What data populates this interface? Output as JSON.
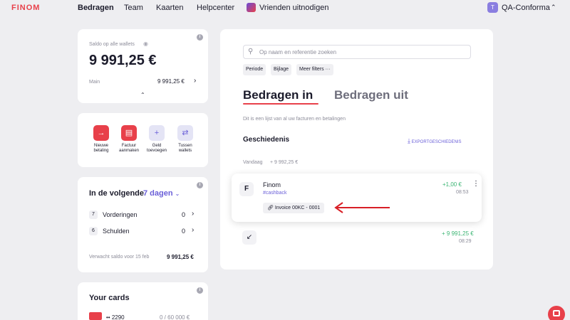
{
  "nav": {
    "logo": "FINOM",
    "items": [
      "Bedragen",
      "Team",
      "Kaarten",
      "Helpcenter",
      "Vrienden uitnodigen"
    ],
    "account_initial": "T",
    "account_name": "QA-Conforma"
  },
  "balance": {
    "label": "Saldo op alle wallets",
    "amount": "9 991,25 €",
    "wallet_name": "Main",
    "wallet_amount": "9 991,25 €"
  },
  "actions": [
    {
      "label_line1": "Nieuwe",
      "label_line2": "betaling",
      "icon": "arrow-right-icon",
      "color": "#e8404a"
    },
    {
      "label_line1": "Factuur",
      "label_line2": "aanmaken",
      "icon": "document-icon",
      "color": "#e8404a"
    },
    {
      "label_line1": "Geld",
      "label_line2": "toevoegen",
      "icon": "plus-icon",
      "color": "#e4e4f5"
    },
    {
      "label_line1": "Tussen",
      "label_line2": "wallets",
      "icon": "swap-icon",
      "color": "#e4e4f5"
    }
  ],
  "upcoming": {
    "title": "In de volgende",
    "period": "7 dagen",
    "rows": [
      {
        "badge": "7",
        "label": "Vorderingen",
        "value": "0"
      },
      {
        "badge": "6",
        "label": "Schulden",
        "value": "0"
      }
    ],
    "expected_label": "Verwacht saldo voor 15 feb",
    "expected_amount": "9 991,25 €"
  },
  "cards": {
    "title": "Your cards",
    "card_number": "•• 2290",
    "limit": "0 / 60 000 €"
  },
  "main": {
    "search_placeholder": "Op naam en referentie zoeken",
    "filters": [
      "Periode",
      "Bijlage",
      "Meer filters"
    ],
    "tab_in": "Bedragen in",
    "tab_out": "Bedragen uit",
    "description": "Dit is een lijst van al uw facturen en betalingen",
    "history_title": "Geschiedenis",
    "export_label": "EXPORTGESCHIEDENIS",
    "group_label": "Vandaag",
    "group_total": "+ 9 992,25 €",
    "transactions": [
      {
        "name": "Finom",
        "tag": "#cashback",
        "amount": "+1,00 €",
        "time": "08:53",
        "invoice": "Invoice 00KC - 0001"
      },
      {
        "amount": "+ 9 991,25 €",
        "time": "08:29"
      }
    ]
  },
  "colors": {
    "brand": "#e8404a",
    "accent": "#6a5fd8",
    "positive": "#3bb573"
  }
}
